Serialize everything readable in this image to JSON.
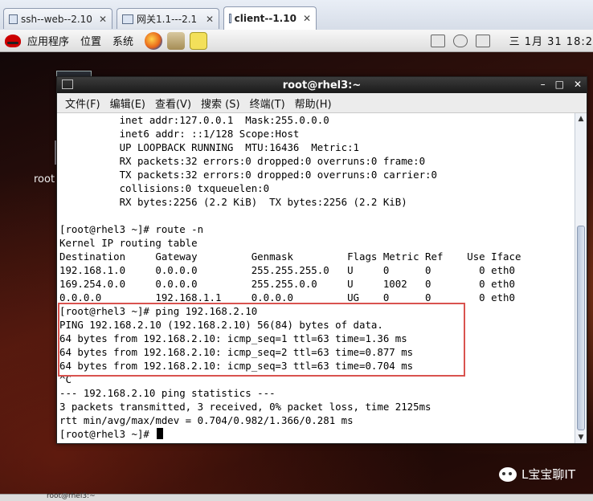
{
  "tabs": [
    {
      "label": "ssh--web--2.10",
      "active": false
    },
    {
      "label": "网关1.1---2.1",
      "active": false
    },
    {
      "label": "client--1.10",
      "active": true
    }
  ],
  "panel": {
    "apps": "应用程序",
    "places": "位置",
    "system": "系统",
    "clock": "三 1月 31 18:2"
  },
  "desktop": {
    "icon_label": "root"
  },
  "terminal": {
    "title": "root@rhel3:~",
    "menu": [
      "文件(F)",
      "编辑(E)",
      "查看(V)",
      "搜索 (S)",
      "终端(T)",
      "帮助(H)"
    ],
    "lines": [
      "          inet addr:127.0.0.1  Mask:255.0.0.0",
      "          inet6 addr: ::1/128 Scope:Host",
      "          UP LOOPBACK RUNNING  MTU:16436  Metric:1",
      "          RX packets:32 errors:0 dropped:0 overruns:0 frame:0",
      "          TX packets:32 errors:0 dropped:0 overruns:0 carrier:0",
      "          collisions:0 txqueuelen:0",
      "          RX bytes:2256 (2.2 KiB)  TX bytes:2256 (2.2 KiB)",
      "",
      "[root@rhel3 ~]# route -n",
      "Kernel IP routing table",
      "Destination     Gateway         Genmask         Flags Metric Ref    Use Iface",
      "192.168.1.0     0.0.0.0         255.255.255.0   U     0      0        0 eth0",
      "169.254.0.0     0.0.0.0         255.255.0.0     U     1002   0        0 eth0",
      "0.0.0.0         192.168.1.1     0.0.0.0         UG    0      0        0 eth0",
      "[root@rhel3 ~]# ping 192.168.2.10",
      "PING 192.168.2.10 (192.168.2.10) 56(84) bytes of data.",
      "64 bytes from 192.168.2.10: icmp_seq=1 ttl=63 time=1.36 ms",
      "64 bytes from 192.168.2.10: icmp_seq=2 ttl=63 time=0.877 ms",
      "64 bytes from 192.168.2.10: icmp_seq=3 ttl=63 time=0.704 ms",
      "^C",
      "--- 192.168.2.10 ping statistics ---",
      "3 packets transmitted, 3 received, 0% packet loss, time 2125ms",
      "rtt min/avg/max/mdev = 0.704/0.982/1.366/0.281 ms",
      "[root@rhel3 ~]# "
    ]
  },
  "watermark": "L宝宝聊IT",
  "taskbar_text": "root@rhel3:~"
}
